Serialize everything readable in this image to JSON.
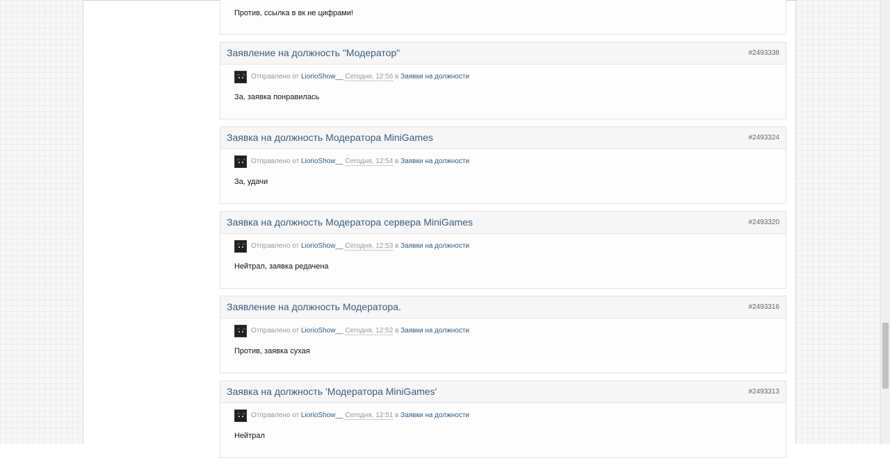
{
  "results": [
    {
      "title": "",
      "id": "",
      "body": "Против, ссылка в вк не цифрами!"
    },
    {
      "title": "Заявление на должность \"Модератор\"",
      "id": "#2493338",
      "sent_by": "Отправлено от",
      "author": "LiorioShow__",
      "date": "Сегодня, 12:56",
      "in": "в",
      "forum": "Заявки на должности",
      "body": "За, заявка понравилась"
    },
    {
      "title": "Заявка на должность Модератора MiniGames",
      "id": "#2493324",
      "sent_by": "Отправлено от",
      "author": "LiorioShow__",
      "date": "Сегодня, 12:54",
      "in": "в",
      "forum": "Заявки на должности",
      "body": "За, удачи"
    },
    {
      "title": "Заявка на должность Модератора сервера MiniGames",
      "id": "#2493320",
      "sent_by": "Отправлено от",
      "author": "LiorioShow__",
      "date": "Сегодня, 12:53",
      "in": "в",
      "forum": "Заявки на должности",
      "body": "Нейтрал, заявка редачена"
    },
    {
      "title": "Заявление на должность Модератора.",
      "id": "#2493316",
      "sent_by": "Отправлено от",
      "author": "LiorioShow__",
      "date": "Сегодня, 12:52",
      "in": "в",
      "forum": "Заявки на должности",
      "body": "Против, заявка сухая"
    },
    {
      "title": "Заявка на должность 'Модератора MiniGames'",
      "id": "#2493313",
      "sent_by": "Отправлено от",
      "author": "LiorioShow__",
      "date": "Сегодня, 12:51",
      "in": "в",
      "forum": "Заявки на должности",
      "body": "Нейтрал"
    }
  ]
}
